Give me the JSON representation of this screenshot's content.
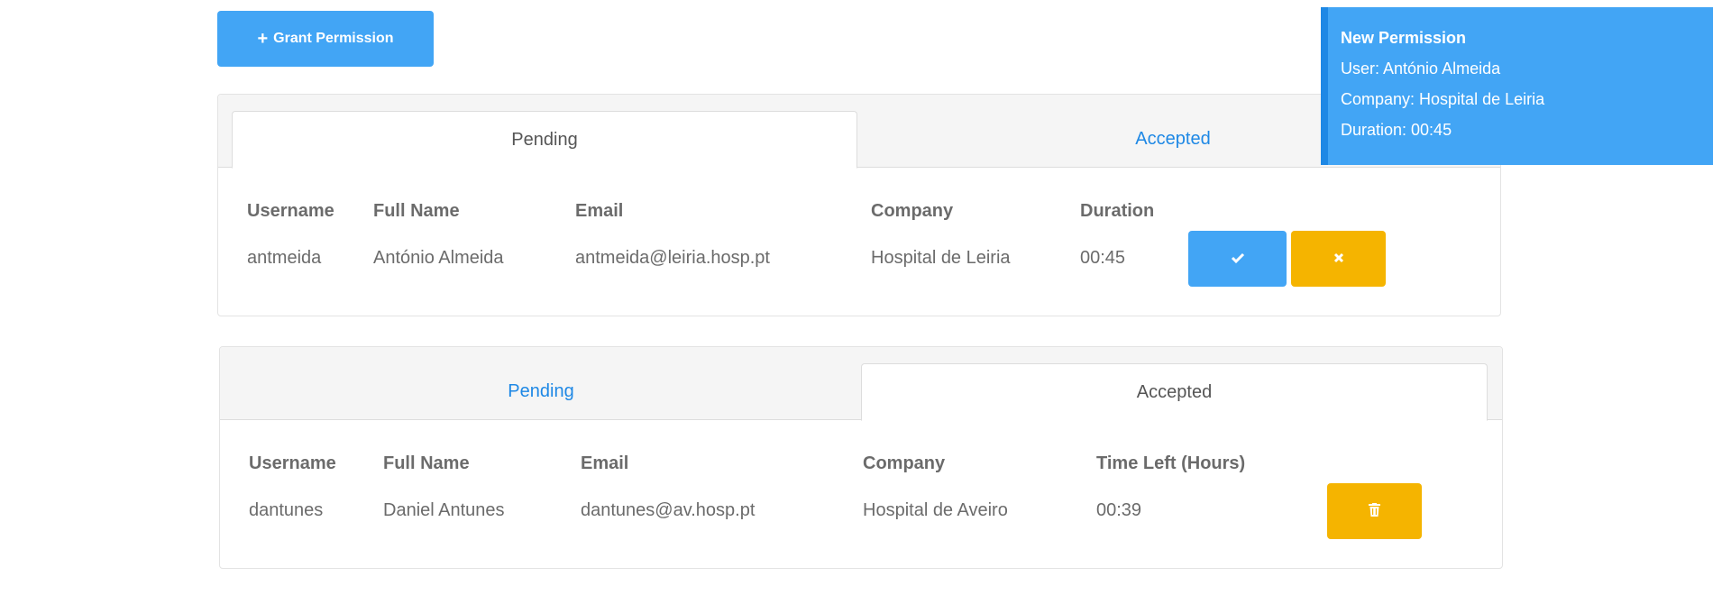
{
  "toolbar": {
    "grant_label": "Grant Permission",
    "grant_icon": "plus-icon"
  },
  "pending_panel": {
    "tabs": [
      {
        "label": "Pending",
        "active": true
      },
      {
        "label": "Accepted",
        "active": false
      }
    ],
    "columns": [
      "Username",
      "Full Name",
      "Email",
      "Company",
      "Duration"
    ],
    "rows": [
      {
        "username": "antmeida",
        "full_name": "António Almeida",
        "email": "antmeida@leiria.hosp.pt",
        "company": "Hospital de Leiria",
        "duration": "00:45",
        "accept_icon": "check-icon",
        "reject_icon": "x-icon"
      }
    ]
  },
  "accepted_panel": {
    "tabs": [
      {
        "label": "Pending",
        "active": false
      },
      {
        "label": "Accepted",
        "active": true
      }
    ],
    "columns": [
      "Username",
      "Full Name",
      "Email",
      "Company",
      "Time Left (Hours)"
    ],
    "rows": [
      {
        "username": "dantunes",
        "full_name": "Daniel Antunes",
        "email": "dantunes@av.hosp.pt",
        "company": "Hospital de Aveiro",
        "time_left": "00:39",
        "delete_icon": "trash-icon"
      }
    ]
  },
  "notification": {
    "title": "New Permission",
    "user_line": "User: António Almeida",
    "company_line": "Company: Hospital de Leiria",
    "duration_line": "Duration: 00:45"
  },
  "colors": {
    "primary": "#42a5f5",
    "warning": "#f5b400",
    "link": "#1e88e5",
    "text": "#6b6b6b"
  }
}
